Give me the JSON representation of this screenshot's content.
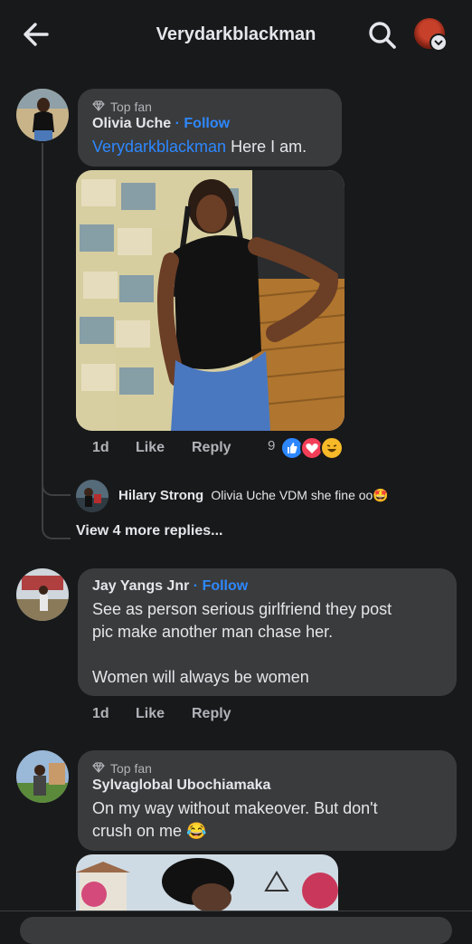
{
  "header": {
    "title": "Verydarkblackman"
  },
  "comments": [
    {
      "badge": "Top fan",
      "name": "Olivia Uche",
      "follow": "Follow",
      "mention": "Verydarkblackman",
      "text": "Here I am.",
      "time": "1d",
      "like": "Like",
      "reply": "Reply",
      "reaction_count": "9",
      "reply_preview": {
        "name": "Hilary Strong",
        "text": "Olivia Uche VDM she fine oo",
        "emoji": "🤩"
      },
      "view_more": "View 4 more replies..."
    },
    {
      "name": "Jay Yangs Jnr",
      "follow": "Follow",
      "text_line1": "See as person serious girlfriend they post",
      "text_line2": "pic make another man chase her.",
      "text_line3": "Women will always be women",
      "time": "1d",
      "like": "Like",
      "reply": "Reply"
    },
    {
      "badge": "Top fan",
      "name": "Sylvaglobal Ubochiamaka",
      "text_line1": "On my way without makeover. But don't",
      "text_line2": "crush on me",
      "emoji": "😂"
    }
  ],
  "colors": {
    "background": "#18191a",
    "bubble": "#3a3b3c",
    "link": "#2d88ff",
    "secondary_text": "#b0b3b8"
  }
}
